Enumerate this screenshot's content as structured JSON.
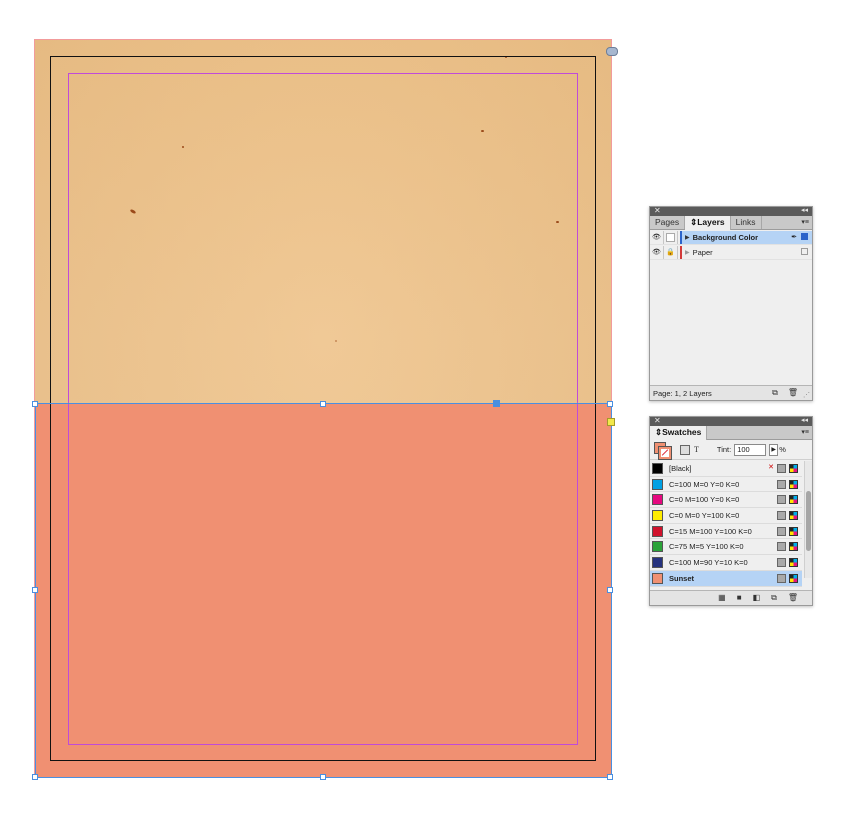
{
  "layers_panel": {
    "tabs": [
      {
        "label": "Pages",
        "active": false
      },
      {
        "label": "Layers",
        "active": true
      },
      {
        "label": "Links",
        "active": false
      }
    ],
    "layers": [
      {
        "name": "Background Color",
        "selected": true,
        "locked": false,
        "color": "#2b63c9"
      },
      {
        "name": "Paper",
        "selected": false,
        "locked": true,
        "color": "#d23a3a"
      }
    ],
    "footer_status": "Page: 1, 2 Layers"
  },
  "swatches_panel": {
    "tab_label": "Swatches",
    "tint_label": "Tint:",
    "tint_value": "100",
    "tint_unit": "%",
    "fill_color": "#f09072",
    "swatches": [
      {
        "name": "[Black]",
        "color": "#000000",
        "selected": false
      },
      {
        "name": "C=100 M=0 Y=0 K=0",
        "color": "#00a0e3",
        "selected": false
      },
      {
        "name": "C=0 M=100 Y=0 K=0",
        "color": "#e5087f",
        "selected": false
      },
      {
        "name": "C=0 M=0 Y=100 K=0",
        "color": "#ffec00",
        "selected": false
      },
      {
        "name": "C=15 M=100 Y=100 K=0",
        "color": "#d0112b",
        "selected": false
      },
      {
        "name": "C=75 M=5 Y=100 K=0",
        "color": "#2ba339",
        "selected": false
      },
      {
        "name": "C=100 M=90 Y=10 K=0",
        "color": "#25327e",
        "selected": false
      },
      {
        "name": "Sunset",
        "color": "#f09072",
        "selected": true
      }
    ]
  },
  "document": {
    "paper_color": "#efc792",
    "background_color_fill": "#f09072",
    "margin_guide_color": "#c04bd8",
    "selection_color": "#4a8fe0"
  }
}
